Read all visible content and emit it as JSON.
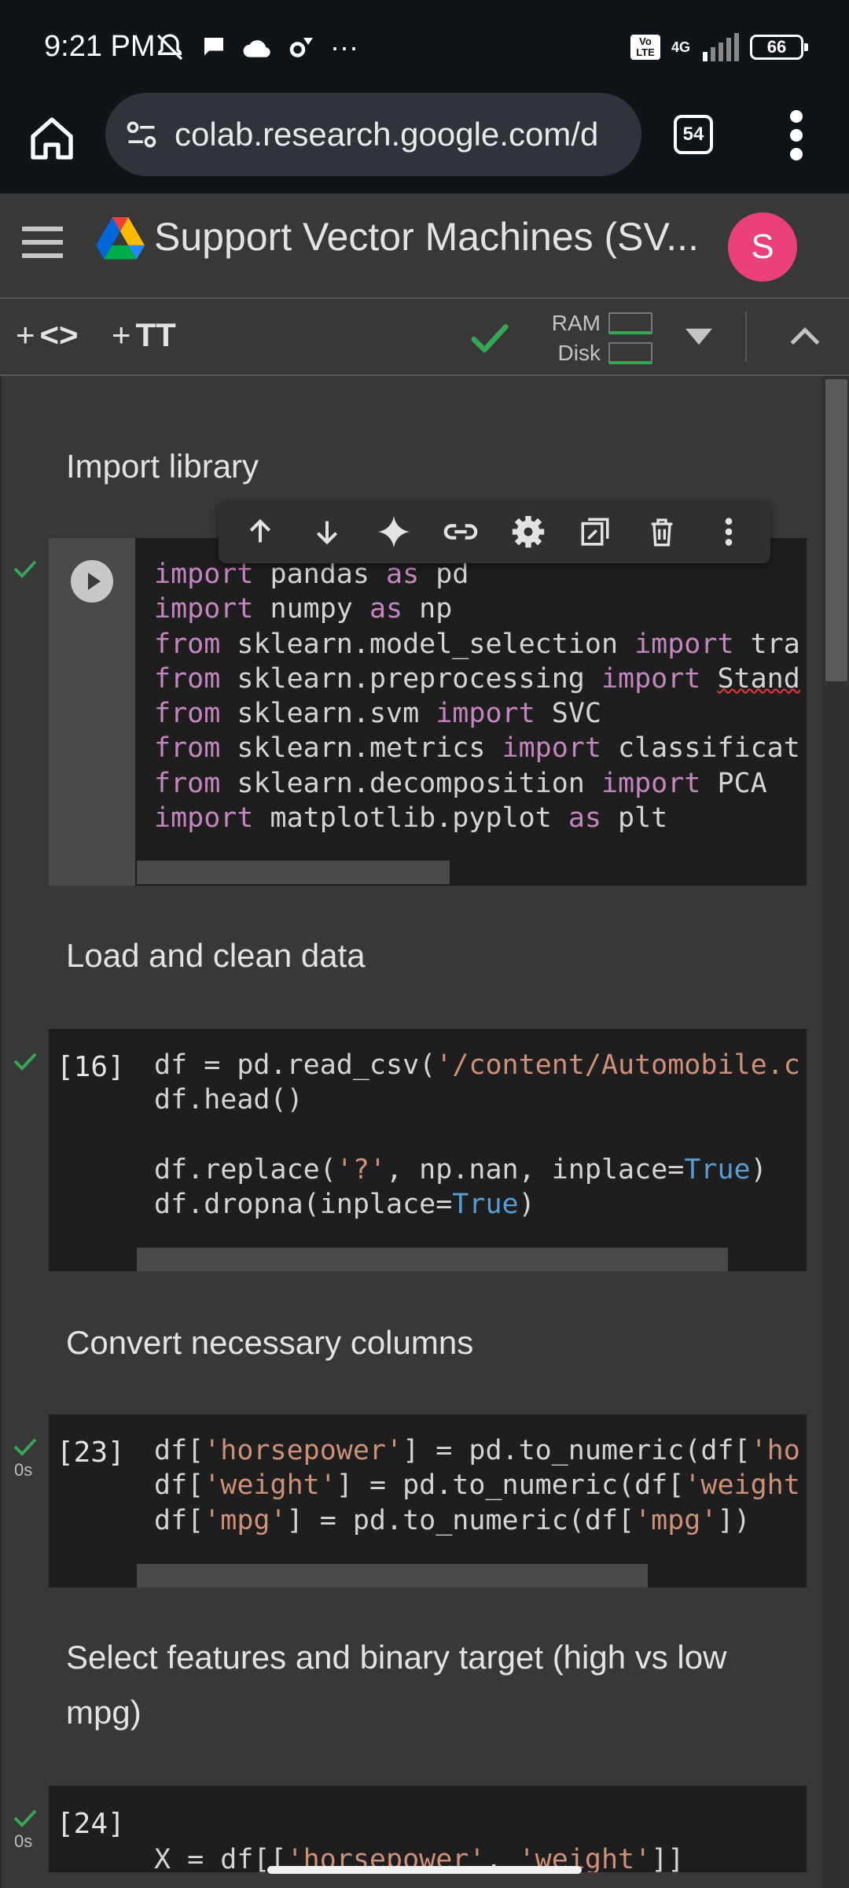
{
  "status_bar": {
    "time": "9:21 PM",
    "network": "4G",
    "lte_badge": "Vo LTE",
    "battery": "66",
    "more": "···"
  },
  "browser": {
    "url": "colab.research.google.com/d",
    "tab_count": "54"
  },
  "colab": {
    "title": "Support Vector Machines (SV...",
    "avatar_initial": "S"
  },
  "toolbar": {
    "add_code_plus": "+",
    "add_code_glyph": "<>",
    "add_text_plus": "+",
    "add_text_glyph": "TT",
    "ram_label": "RAM",
    "disk_label": "Disk"
  },
  "sections": [
    {
      "heading": "Import library"
    },
    {
      "heading": "Load and clean data",
      "exec_count": "[16]"
    },
    {
      "heading": "Convert necessary columns",
      "exec_count": "[23]",
      "time": "0s"
    },
    {
      "heading": "Select features and binary target (high vs low mpg)",
      "exec_count": "[24]",
      "time": "0s"
    }
  ],
  "colors": {
    "keyword": "#c586c0",
    "string": "#ce9178",
    "constant": "#569cd6",
    "success": "#34a853",
    "avatar": "#ec407a"
  }
}
